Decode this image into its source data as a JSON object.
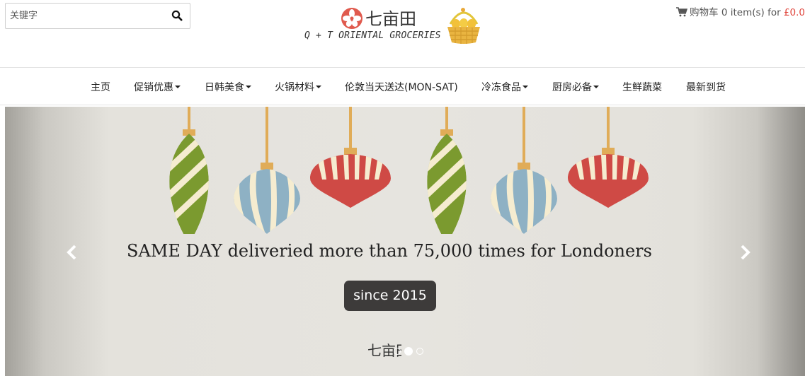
{
  "header": {
    "search": {
      "placeholder": "关键字"
    },
    "logo": {
      "chinese": "七亩田",
      "english": "Q + T ORIENTAL GROCERIES"
    },
    "cart": {
      "label": "购物车",
      "count": "0",
      "items_text": "item(s) for",
      "total": "£0.0"
    }
  },
  "nav": {
    "items": [
      {
        "label": "主页",
        "dropdown": false
      },
      {
        "label": "促销优惠",
        "dropdown": true
      },
      {
        "label": "日韩美食",
        "dropdown": true
      },
      {
        "label": "火锅材料",
        "dropdown": true
      },
      {
        "label": "伦敦当天送达(MON-SAT)",
        "dropdown": false
      },
      {
        "label": "冷冻食品",
        "dropdown": true
      },
      {
        "label": "厨房必备",
        "dropdown": true
      },
      {
        "label": "生鲜蔬菜",
        "dropdown": false
      },
      {
        "label": "最新到货",
        "dropdown": false
      }
    ]
  },
  "carousel": {
    "headline": "SAME DAY deliveried more than 75,000 times for Londoners",
    "badge": "since 2015",
    "logo_text": "七亩田",
    "slide_count": 3,
    "active_slide": 2
  },
  "colors": {
    "accent_price": "#e0453c",
    "ornament_green": "#7b9a2f",
    "ornament_blue": "#8eb1c4",
    "ornament_red": "#cf4a45",
    "ornament_cream": "#f5ecd0",
    "string_gold": "#e0ac58",
    "badge_bg": "#3d3b3a"
  },
  "icons": {
    "search": "search-icon",
    "cart": "cart-icon",
    "prev": "chevron-left-icon",
    "next": "chevron-right-icon"
  }
}
